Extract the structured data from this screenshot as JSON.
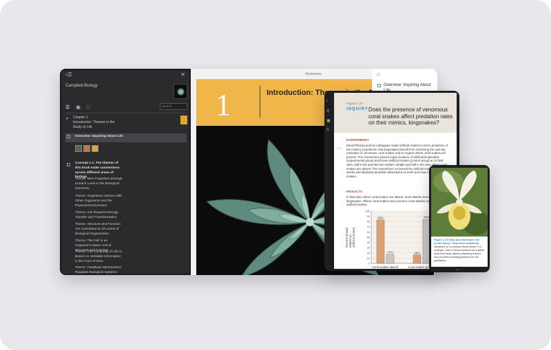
{
  "laptop": {
    "sidebar": {
      "title": "Campbell Biology",
      "search_placeholder": "Search",
      "chapter_label": "Chapter 1",
      "chapter_title": "Introduction: Themes in the Study of Life",
      "overview_item": "Overview: Inquiring About Life",
      "items": [
        "Concept 1.1: The themes of this book make connections across different areas of biology",
        "Theme: New Properties Emerge at Each Level in the Biological Hierarchy",
        "Theme: Organisms Interact with Other Organisms and the Physical Environment",
        "Theme: Life Requires Energy Transfer and Transformation",
        "Theme: Structure and Function Are Correlated at All Levels of Biological Organization",
        "Theme: The Cell Is an Organism's Basic Unit of Structure and Function",
        "Theme: The Continuity of Life Is Based on Heritable Information in the Form of DNA",
        "Theme: Feedback Mechanisms Regulate Biological Systems"
      ]
    },
    "reader": {
      "header": "Reviewers",
      "chapter_number": "1",
      "chapter_title": "Introduction: Themes in the Study of Life"
    },
    "overview_panel": {
      "text": "Overview: Inquiring About Life"
    }
  },
  "tablet": {
    "figure_label": "Figure 1.27",
    "inquiry_label": "INQUIRY",
    "question": "Does the presence of venomous coral snakes affect predation rates on their mimics, kingsnakes?",
    "experiment_heading": "EXPERIMENT",
    "experiment_text": "David Pfennig and his colleagues made artificial snakes to test a prediction of the mimicry hypothesis: that kingsnakes benefit from mimicking the warning coloration of venomous coral snakes only in regions where coral snakes are present. The researchers placed equal numbers of artificial kingsnakes (experimental group) and brown artificial snakes (control group) at 14 field sites, half in the area the two snakes cohabit and half in the area where coral snakes are absent. The researchers recovered the artificial snakes after four weeks and tabulated predation data based on teeth and claw marks on the snakes.",
    "results_heading": "RESULTS",
    "results_text": "In field sites where coral snakes are absent, most attacks were on artificial kingsnakes. Where coral snakes were present, most attacks were on brown artificial snakes.",
    "side_label": "1 / 5"
  },
  "chart_data": {
    "type": "bar",
    "ylabel": "Percent of total attacks on artificial snakes",
    "ylim": [
      0,
      100
    ],
    "yticks": [
      0,
      10,
      20,
      30,
      40,
      50,
      60,
      70,
      80,
      90,
      100
    ],
    "categories": [
      "Coral snakes absent",
      "Coral snakes present"
    ],
    "series": [
      {
        "values": [
          83,
          16
        ]
      },
      {
        "values": [
          17,
          84
        ]
      }
    ],
    "value_labels": [
      [
        "83%",
        "17%"
      ],
      [
        "16%",
        "84%"
      ]
    ],
    "colors": [
      "#d9a27a",
      "#c8c8c8"
    ]
  },
  "phone": {
    "caption_label": "Figure 1.10",
    "caption_title": "Unity and diversity in the orchid family.",
    "caption_text": "These three orchids are variations on a common floral theme. For example, each of these flowers has a liplike petal that helps attract pollinating insects and provides a landing platform for the pollinators."
  },
  "colors": {
    "chapter_banner": "#f0b64a",
    "accent_blue": "#2e86c6",
    "section_red": "#c0392b"
  }
}
